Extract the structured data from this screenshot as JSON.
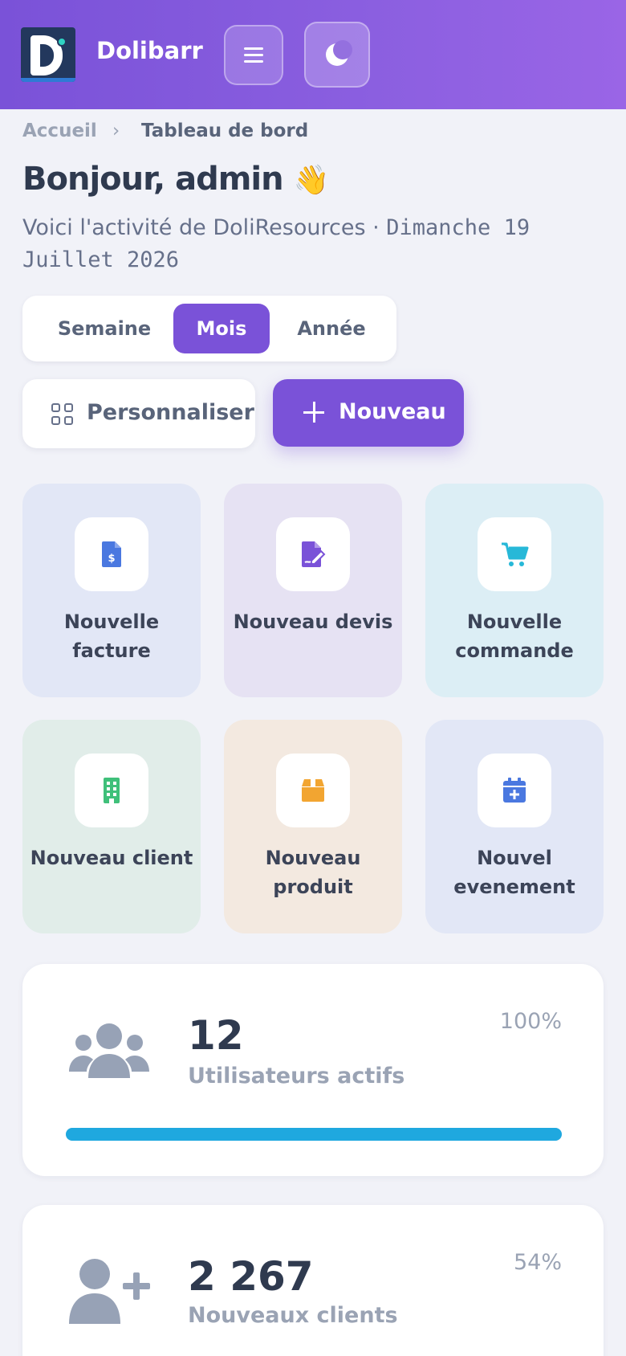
{
  "app": {
    "brand": "Dolibarr"
  },
  "breadcrumb": {
    "home": "Accueil",
    "separator": "›",
    "current": "Tableau de bord"
  },
  "greeting": {
    "title": "Bonjour, admin",
    "emoji": "👋",
    "subtitle": "Voici l'activité de DoliResources · ",
    "date": "Dimanche 19 Juillet 2026"
  },
  "period": {
    "items": [
      "Semaine",
      "Mois",
      "Année"
    ],
    "selected": "Mois"
  },
  "actions": {
    "customize": "Personnaliser",
    "new": "Nouveau"
  },
  "quick": [
    {
      "label": "Nouvelle facture",
      "icon": "invoice-icon",
      "color": "#4a78e0",
      "bg": "#e2e7f6"
    },
    {
      "label": "Nouveau devis",
      "icon": "quote-edit-icon",
      "color": "#7a52d8",
      "bg": "#e6e2f3"
    },
    {
      "label": "Nouvelle commande",
      "icon": "cart-icon",
      "color": "#27b8d8",
      "bg": "#dceef5"
    },
    {
      "label": "Nouveau client",
      "icon": "building-icon",
      "color": "#3fc07a",
      "bg": "#e1ede9"
    },
    {
      "label": "Nouveau produit",
      "icon": "box-icon",
      "color": "#f2a531",
      "bg": "#f3e9e0"
    },
    {
      "label": "Nouvel evenement",
      "icon": "calendar-plus-icon",
      "color": "#4a78e0",
      "bg": "#e2e7f6"
    }
  ],
  "stats": [
    {
      "value": "12",
      "label": "Utilisateurs actifs",
      "percent": "100%",
      "progress": 1.0,
      "bar_color": "#1fa8df",
      "icon": "users-icon"
    },
    {
      "value": "2 267",
      "label": "Nouveaux clients",
      "percent": "54%",
      "progress": 0.54,
      "bar_color": "#1fa8df",
      "icon": "user-plus-icon"
    }
  ],
  "colors": {
    "accent": "#7a52d8",
    "topbar_start": "#7a52d8",
    "topbar_end": "#9a65e6"
  }
}
